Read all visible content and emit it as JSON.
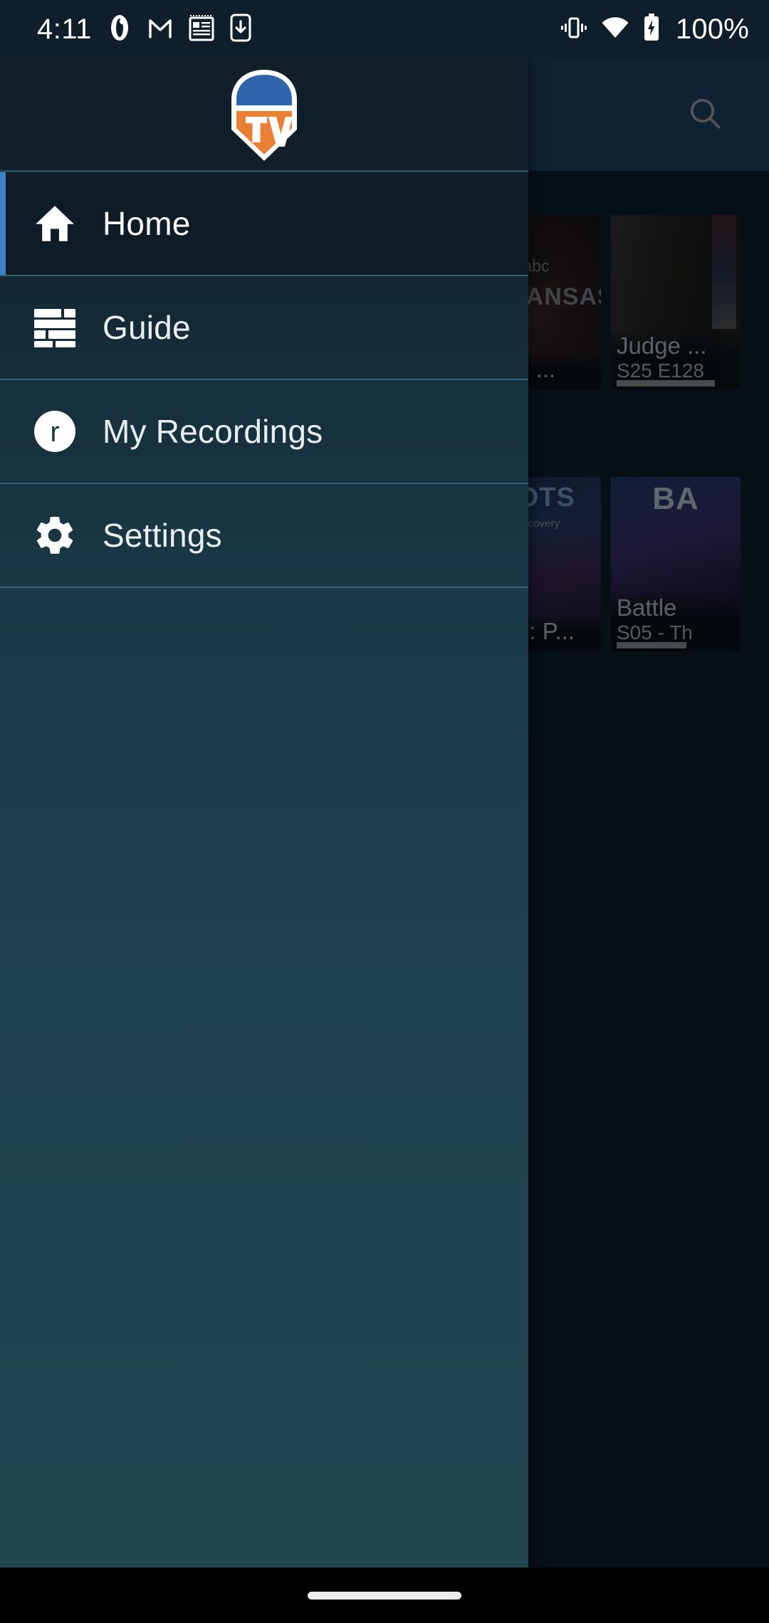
{
  "status_bar": {
    "clock": "4:11",
    "battery_percent": "100%",
    "icons": [
      "opera-icon",
      "gmail-icon",
      "calendar-icon",
      "download-phone-icon",
      "vibrate-icon",
      "wifi-icon",
      "battery-charging-icon"
    ]
  },
  "drawer": {
    "logo_alt": "TV",
    "logo_text": "TV",
    "accent_color": "#3d82c4",
    "items": [
      {
        "label": "Home",
        "icon": "home-icon",
        "active": true
      },
      {
        "label": "Guide",
        "icon": "guide-icon",
        "active": false
      },
      {
        "label": "My Recordings",
        "icon": "recordings-icon",
        "active": false
      },
      {
        "label": "Settings",
        "icon": "gear-icon",
        "active": false
      }
    ]
  },
  "app_bar": {
    "search_icon": "search-icon"
  },
  "content": {
    "rows": [
      {
        "tiles": [
          {
            "title": "noon ...",
            "subtitle": "",
            "network": "abc",
            "banner": "ARKANSAS",
            "progress_pct": 0
          },
          {
            "title": "Judge ...",
            "subtitle": "S25 E128",
            "network": "",
            "banner": "",
            "progress_pct": 88
          }
        ]
      },
      {
        "tiles": [
          {
            "title": "nters: P...",
            "subtitle": "",
            "network": "Discovery",
            "banner": "ROTS",
            "progress_pct": 0
          },
          {
            "title": "Battle",
            "subtitle": "S05 - Th",
            "network": "",
            "banner": "BA",
            "progress_pct": 62
          }
        ]
      }
    ]
  },
  "system_nav": {
    "home_indicator": "home-indicator"
  }
}
